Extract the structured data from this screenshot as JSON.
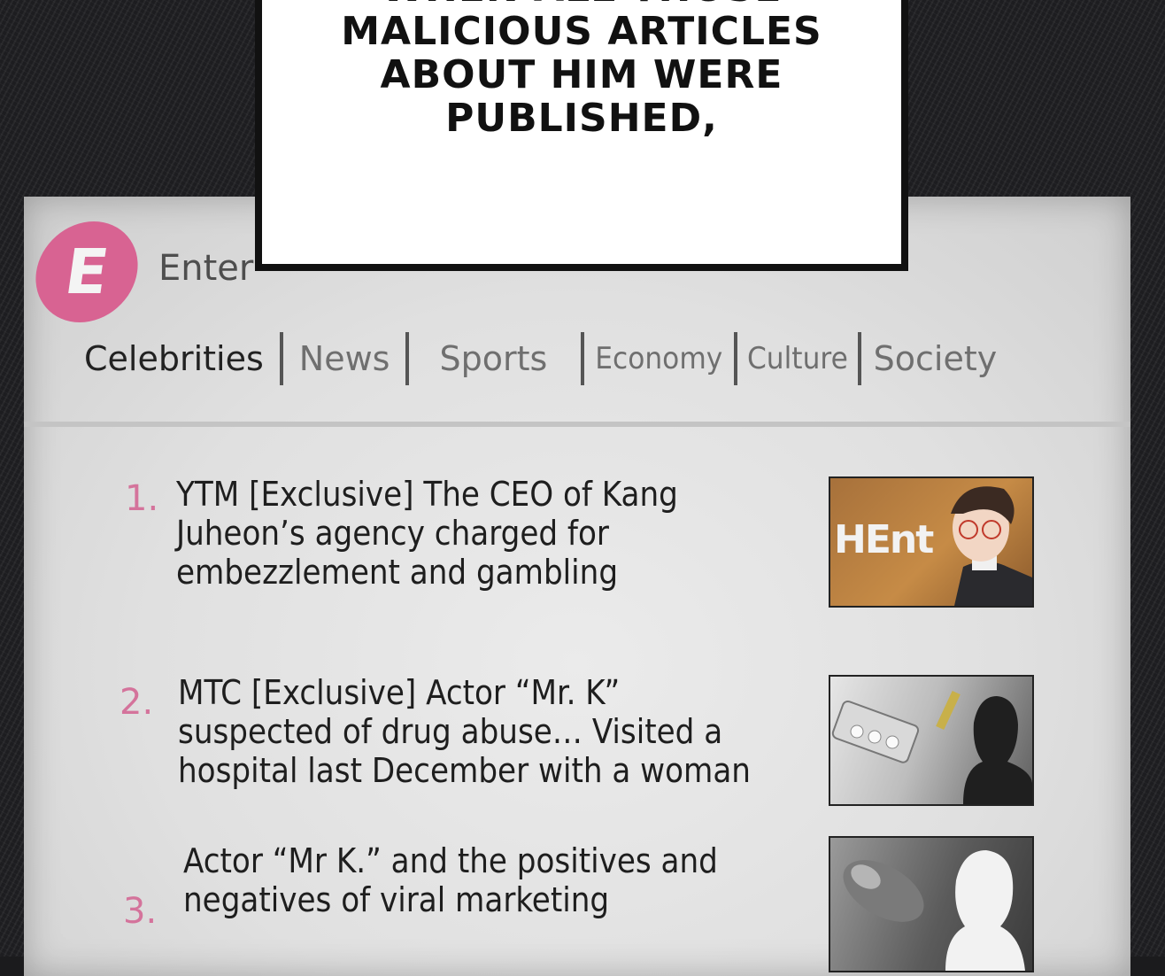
{
  "caption": {
    "text": "WHEN ALL THOSE\nMALICIOUS ARTICLES\nABOUT HIM WERE\nPUBLISHED,"
  },
  "site": {
    "logo_letter": "E",
    "name": "Enter"
  },
  "nav": {
    "items": [
      "Celebrities",
      "News",
      "Sports",
      "Economy",
      "Culture",
      "Society"
    ],
    "active": "Celebrities"
  },
  "articles": [
    {
      "number": "1.",
      "title": "YTM [Exclusive] The CEO of Kang\nJuheon’s agency charged for\nembezzlement and gambling",
      "thumbnail_text": "HEnt"
    },
    {
      "number": "2.",
      "title": "MTC [Exclusive] Actor “Mr. K”\nsuspected of drug abuse… Visited a\nhospital last December with a woman"
    },
    {
      "number": "3.",
      "title": "Actor “Mr K.” and the positives and\nnegatives of viral marketing"
    }
  ],
  "colors": {
    "accent_pink": "#d86392",
    "number_pink": "#d4739b",
    "background_dark": "#1d1d20"
  }
}
